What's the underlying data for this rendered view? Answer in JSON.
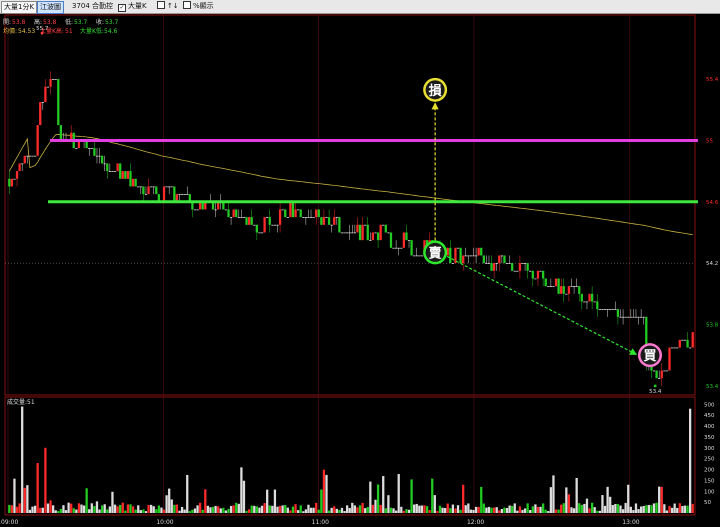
{
  "toolbar": {
    "period_button": "大量1分K",
    "mode_button": "江波圖",
    "stock": "3704 合勤控",
    "check_bigk": "大量K",
    "check_percent": "%顯示",
    "check_bigk_checked": true,
    "check_percent_checked": false
  },
  "info": {
    "open_label": "開:",
    "open_value": "53.8",
    "high_label": "高:",
    "high_value": "53.8",
    "low_label": "低:",
    "low_value": "53.7",
    "close_label": "收:",
    "close_value": "53.7",
    "avg_label": "均價:",
    "avg_value": "54.53",
    "bigk_high_label": "大量K高:",
    "bigk_high_value": "51",
    "bigk_low_label": "大量K低:",
    "bigk_low_value": "54.6"
  },
  "volume_panel_label": "成交量:51",
  "annotations": {
    "stop": "損",
    "sell": "賣",
    "buy": "買"
  },
  "colors": {
    "up": "#ff2a2a",
    "down": "#22cc22",
    "flat": "#dddddd",
    "avg_line": "#c8b040",
    "magenta_line": "#e23ee2",
    "green_line": "#3ee83e",
    "stop_marker": "#e8e030",
    "sell_marker": "#2ee82e",
    "buy_marker": "#ff7ad0",
    "frame": "#8a1010"
  },
  "chart_data": {
    "type": "candlestick",
    "x_tick_labels": [
      "09:00",
      "10:00",
      "11:00",
      "12:00",
      "13:00"
    ],
    "x_range": [
      "09:00",
      "13:25"
    ],
    "price_tick_labels": [
      "55.4",
      "55",
      "54.6",
      "54.2",
      "53.8",
      "53.4"
    ],
    "price_ylim": [
      53.36,
      55.72
    ],
    "reference_price": 54.2,
    "high_label": "55.7",
    "low_label": "53.4",
    "volume_tick_labels": [
      "500",
      "450",
      "400",
      "350",
      "300",
      "250",
      "200",
      "150",
      "100",
      "50"
    ],
    "volume_ylim": [
      0,
      520
    ],
    "magenta_level": 55.0,
    "green_level": 54.6,
    "stop_level": 55.33,
    "sell_time": "11:45",
    "sell_price": 54.27,
    "buy_time": "13:08",
    "buy_price": 53.6,
    "low_time": "13:10"
  }
}
